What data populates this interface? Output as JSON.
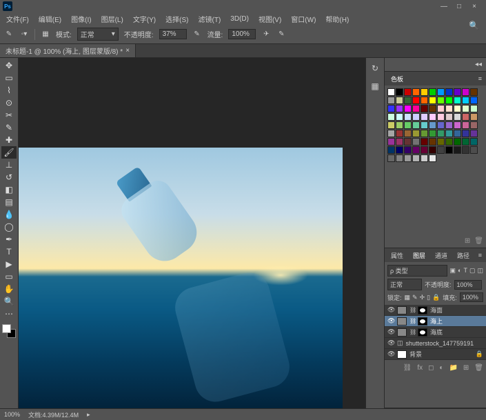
{
  "app": {
    "name": "Ps"
  },
  "window": {
    "minimize": "—",
    "maximize": "□",
    "close": "×"
  },
  "menu": {
    "file": "文件(F)",
    "edit": "编辑(E)",
    "image": "图像(I)",
    "layer": "图层(L)",
    "type": "文字(Y)",
    "select": "选择(S)",
    "filter": "滤镜(T)",
    "threed": "3D(D)",
    "view": "视图(V)",
    "window": "窗口(W)",
    "help": "帮助(H)"
  },
  "options": {
    "mode_label": "模式:",
    "mode_value": "正常",
    "opacity_label": "不透明度:",
    "opacity_value": "37%",
    "flow_label": "流量:",
    "flow_value": "100%"
  },
  "document": {
    "tab_title": "未标题-1 @ 100% (海上, 图层蒙版/8) *",
    "close": "×"
  },
  "status": {
    "zoom": "100%",
    "doc_info": "文档:4.39M/12.4M"
  },
  "swatches_panel": {
    "title": "色板",
    "colors": [
      "#ffffff",
      "#000000",
      "#cc0000",
      "#ff6600",
      "#ffcc00",
      "#00cc00",
      "#0099ff",
      "#0033cc",
      "#6600cc",
      "#cc00cc",
      "#663300",
      "#999999",
      "#cccc99",
      "#336633",
      "#ff0000",
      "#ff6600",
      "#ffff00",
      "#66ff00",
      "#00ff00",
      "#00ffcc",
      "#00ccff",
      "#0066ff",
      "#3333ff",
      "#9933ff",
      "#ff00ff",
      "#ff0099",
      "#660000",
      "#663300",
      "#ffcccc",
      "#ffe0cc",
      "#ffffcc",
      "#e0ffcc",
      "#ccffcc",
      "#ccffe0",
      "#ccffff",
      "#cce0ff",
      "#ccccff",
      "#e0ccff",
      "#ffccff",
      "#ffcce0",
      "#e0cccc",
      "#d9d9d9",
      "#cc6666",
      "#cc9966",
      "#cccc66",
      "#99cc66",
      "#66cc66",
      "#66cc99",
      "#66cccc",
      "#6699cc",
      "#6666cc",
      "#9966cc",
      "#cc66cc",
      "#cc6699",
      "#996666",
      "#a6a6a6",
      "#993333",
      "#996633",
      "#999933",
      "#669933",
      "#339933",
      "#339966",
      "#339999",
      "#336699",
      "#333399",
      "#663399",
      "#993399",
      "#993366",
      "#663333",
      "#737373",
      "#660000",
      "#663300",
      "#666600",
      "#336600",
      "#006600",
      "#006633",
      "#006666",
      "#003366",
      "#000066",
      "#330066",
      "#660066",
      "#660033",
      "#330000",
      "#404040",
      "#000000",
      "#1a1a1a",
      "#333333",
      "#4d4d4d",
      "#666666",
      "#808080",
      "#999999",
      "#b3b3b3",
      "#cccccc",
      "#e6e6e6"
    ]
  },
  "layers_panel": {
    "tab_properties": "属性",
    "tab_layers": "图层",
    "tab_channels": "通道",
    "tab_paths": "路径",
    "kind_label": "ρ 类型",
    "blend_mode": "正常",
    "opacity_label": "不透明度:",
    "opacity_value": "100%",
    "lock_label": "锁定:",
    "fill_label": "填充:",
    "fill_value": "100%",
    "layers": [
      {
        "name": "海面",
        "visible": true,
        "has_mask": true,
        "selected": false
      },
      {
        "name": "海上",
        "visible": true,
        "has_mask": true,
        "selected": true
      },
      {
        "name": "海底",
        "visible": true,
        "has_mask": true,
        "selected": false
      },
      {
        "name": "shutterstock_147759191",
        "visible": true,
        "smart": true,
        "selected": false
      },
      {
        "name": "背景",
        "visible": true,
        "locked": true,
        "selected": false
      }
    ]
  }
}
